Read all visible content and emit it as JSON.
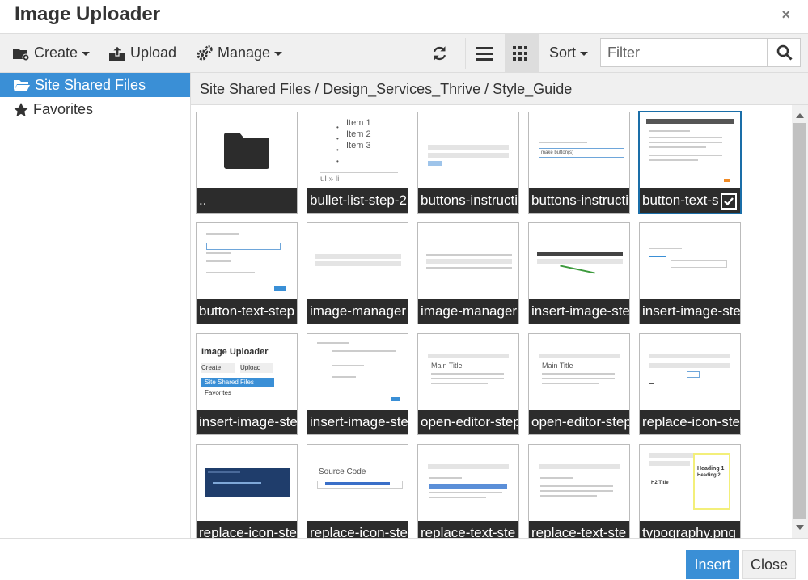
{
  "dialog": {
    "title": "Image Uploader",
    "close_glyph": "×"
  },
  "toolbar": {
    "create_label": "Create",
    "upload_label": "Upload",
    "manage_label": "Manage",
    "sort_label": "Sort",
    "filter_placeholder": "Filter",
    "icons": [
      "folder-plus-icon",
      "upload-icon",
      "gears-icon",
      "refresh-icon",
      "list-view-icon",
      "grid-view-icon",
      "search-icon"
    ]
  },
  "sidebar": {
    "items": [
      {
        "label": "Site Shared Files",
        "icon": "folder-open-icon",
        "active": true
      },
      {
        "label": "Favorites",
        "icon": "star-icon",
        "active": false
      }
    ]
  },
  "breadcrumb": "Site Shared Files / Design_Services_Thrive / Style_Guide",
  "files": [
    {
      "name": "..",
      "kind": "folder"
    },
    {
      "name": "bullet-list-step-2",
      "kind": "image",
      "thumb_text": [
        "Item 1",
        "Item 2",
        "Item 3",
        "",
        "ul » li"
      ]
    },
    {
      "name": "buttons-instructi",
      "kind": "image"
    },
    {
      "name": "buttons-instructi",
      "kind": "image",
      "thumb_text": [
        "make button(s)"
      ]
    },
    {
      "name": "button-text-s",
      "kind": "image",
      "selected": true
    },
    {
      "name": "button-text-step",
      "kind": "image"
    },
    {
      "name": "image-manager",
      "kind": "image"
    },
    {
      "name": "image-manager",
      "kind": "image"
    },
    {
      "name": "insert-image-ste",
      "kind": "image"
    },
    {
      "name": "insert-image-ste",
      "kind": "image"
    },
    {
      "name": "insert-image-ste",
      "kind": "image",
      "thumb_text": [
        "Image Uploader",
        "Create",
        "Upload",
        "Site Shared Files",
        "Favorites"
      ]
    },
    {
      "name": "insert-image-ste",
      "kind": "image"
    },
    {
      "name": "open-editor-step",
      "kind": "image",
      "thumb_text": [
        "Main Title"
      ]
    },
    {
      "name": "open-editor-step",
      "kind": "image",
      "thumb_text": [
        "Main Title"
      ]
    },
    {
      "name": "replace-icon-ste",
      "kind": "image"
    },
    {
      "name": "replace-icon-ste",
      "kind": "image"
    },
    {
      "name": "replace-icon-ste",
      "kind": "image",
      "thumb_text": [
        "Source Code"
      ]
    },
    {
      "name": "replace-text-ste",
      "kind": "image"
    },
    {
      "name": "replace-text-ste",
      "kind": "image"
    },
    {
      "name": "typography.png",
      "kind": "image",
      "thumb_text": [
        "Heading 1",
        "Heading 2",
        "H2 Title"
      ]
    }
  ],
  "footer": {
    "insert_label": "Insert",
    "close_label": "Close"
  },
  "colors": {
    "accent": "#3a8fd6",
    "caption_bg": "#2c2c2c",
    "selected_border": "#1a6ea8"
  }
}
